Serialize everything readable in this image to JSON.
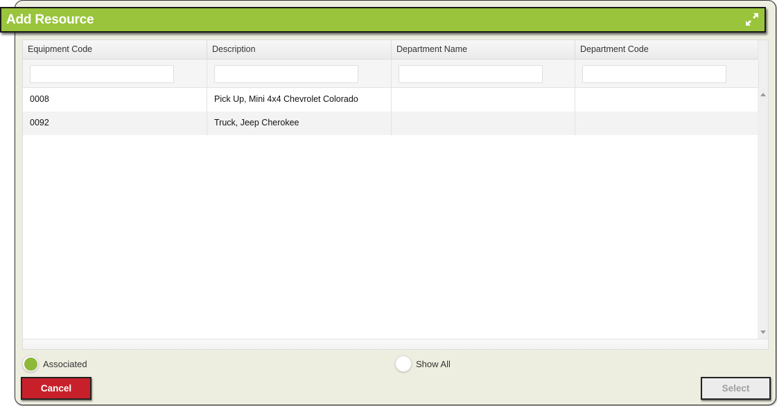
{
  "dialog": {
    "title": "Add Resource",
    "expand_icon": "expand-arrows-icon"
  },
  "grid": {
    "columns": [
      {
        "label": "Equipment Code",
        "filter_value": ""
      },
      {
        "label": "Description",
        "filter_value": ""
      },
      {
        "label": "Department Name",
        "filter_value": ""
      },
      {
        "label": "Department Code",
        "filter_value": ""
      }
    ],
    "rows": [
      {
        "equipment_code": "0008",
        "description": "Pick Up, Mini 4x4 Chevrolet Colorado",
        "department_name": "",
        "department_code": ""
      },
      {
        "equipment_code": "0092",
        "description": "Truck, Jeep Cherokee",
        "department_name": "",
        "department_code": ""
      }
    ]
  },
  "filters": {
    "associated": {
      "label": "Associated",
      "selected": true
    },
    "show_all": {
      "label": "Show All",
      "selected": false
    }
  },
  "buttons": {
    "cancel": "Cancel",
    "select": "Select"
  },
  "colors": {
    "title_bar": "#99c43c",
    "cancel": "#c8202a",
    "radio_selected": "#8db83a",
    "dialog_bg": "#eeeee0"
  }
}
